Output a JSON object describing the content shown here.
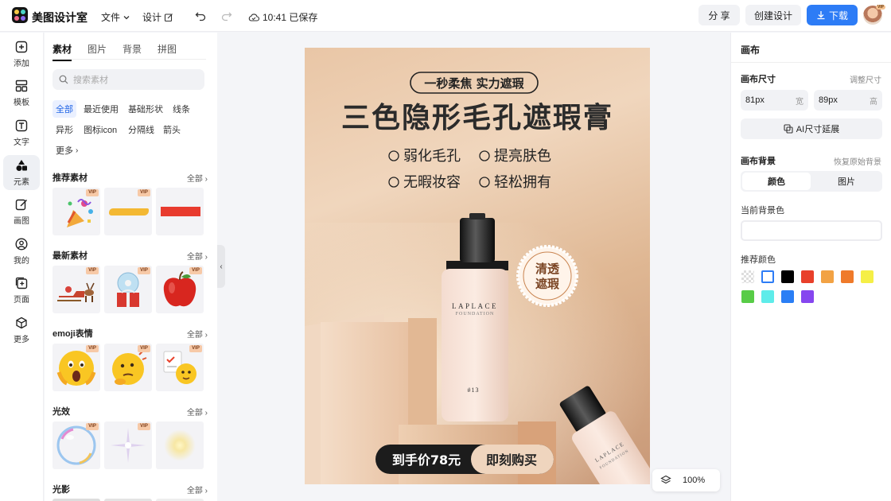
{
  "topbar": {
    "app_name": "美图设计室",
    "menu_file": "文件",
    "menu_design": "设计",
    "save_status": "10:41 已保存",
    "share": "分 享",
    "create": "创建设计",
    "download": "下载",
    "avatar_badge": "VIP"
  },
  "rail": [
    {
      "label": "添加",
      "icon": "plus-square-icon"
    },
    {
      "label": "模板",
      "icon": "template-icon"
    },
    {
      "label": "文字",
      "icon": "text-icon"
    },
    {
      "label": "元素",
      "icon": "shapes-icon"
    },
    {
      "label": "画图",
      "icon": "pen-icon"
    },
    {
      "label": "我的",
      "icon": "user-icon"
    },
    {
      "label": "页面",
      "icon": "page-add-icon"
    },
    {
      "label": "更多",
      "icon": "cube-icon"
    }
  ],
  "panel": {
    "tabs": [
      "素材",
      "图片",
      "背景",
      "拼图"
    ],
    "search_placeholder": "搜索素材",
    "chips": [
      "全部",
      "最近使用",
      "基础形状",
      "线条",
      "异形",
      "图标icon",
      "分隔线",
      "箭头",
      "更多"
    ],
    "vip": "VIP",
    "all": "全部",
    "sections": [
      "推荐素材",
      "最新素材",
      "emoji表情",
      "光效",
      "光影"
    ]
  },
  "poster": {
    "tag": "一秒柔焦 实力遮瑕",
    "title": "三色隐形毛孔遮瑕膏",
    "feature1": "弱化毛孔",
    "feature2": "提亮肤色",
    "feature3": "无暇妆容",
    "feature4": "轻松拥有",
    "seal": "清透遮瑕",
    "brand": "LAPLACE",
    "subbrand": "FOUNDATION",
    "shade": "#13",
    "price": "到手价78元",
    "cta": "即刻购买"
  },
  "zoom": "100%",
  "right": {
    "title": "画布",
    "size_label": "画布尺寸",
    "size_hint": "调整尺寸",
    "width_value": "81px",
    "width_unit": "宽",
    "height_value": "89px",
    "height_unit": "高",
    "ai_extend": "AI尺寸延展",
    "bg_label": "画布背景",
    "bg_hint": "恢复原始背景",
    "tab_color": "颜色",
    "tab_image": "图片",
    "current_bg": "当前背景色",
    "recommend": "推荐颜色",
    "colors": [
      "transparent",
      "#ffffff",
      "#000000",
      "#e8402a",
      "#f2a244",
      "#ef7a2a",
      "#f5ef46",
      "#58cc47",
      "#5eecea",
      "#2a7ef5",
      "#8646ef"
    ]
  }
}
